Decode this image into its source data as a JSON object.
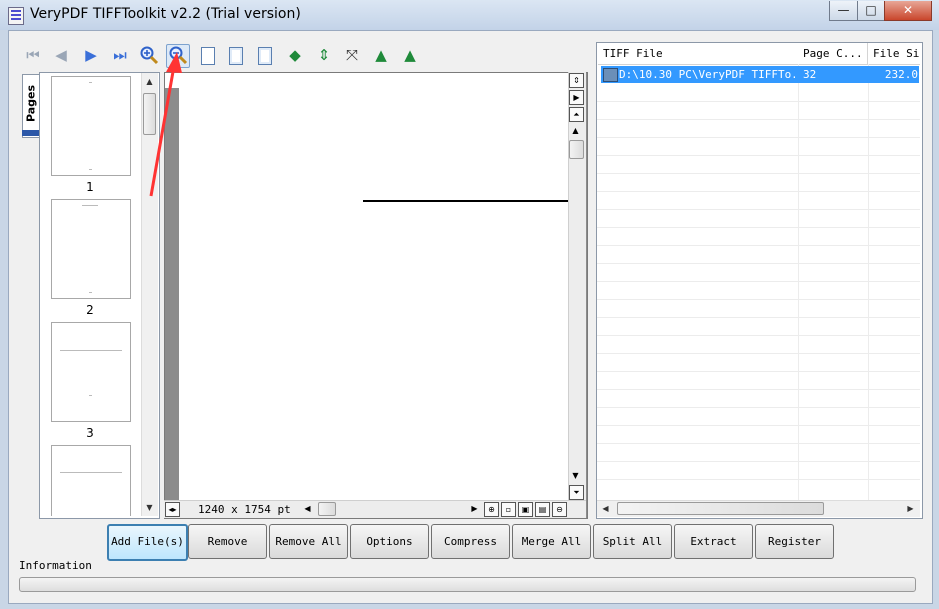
{
  "window": {
    "title": "VeryPDF TIFFToolkit v2.2 (Trial version)",
    "controls": {
      "minimize": "—",
      "maximize": "□",
      "close": "✕"
    }
  },
  "toolbar": {
    "icons": [
      "first-page",
      "previous-page",
      "next-page",
      "last-page",
      "zoom-in",
      "zoom-out",
      "actual-size",
      "fit-page",
      "fit-width",
      "flip-horizontal",
      "flip-vertical",
      "rotate",
      "rotate-left",
      "rotate-right"
    ]
  },
  "pages_tab": {
    "label": "Pages"
  },
  "thumbnails": [
    {
      "number": "1"
    },
    {
      "number": "2"
    },
    {
      "number": "3"
    }
  ],
  "preview": {
    "dimensions": "1240 x 1754 pt"
  },
  "file_list": {
    "columns": [
      "TIFF File",
      "Page C...",
      "File Si"
    ],
    "rows": [
      {
        "file": "D:\\10.30 PC\\VeryPDF TIFFTo...",
        "pages": "32",
        "size": "232.0"
      }
    ]
  },
  "buttons": {
    "add_files": "Add File(s)",
    "remove": "Remove",
    "remove_all": "Remove All",
    "options": "Options",
    "compress": "Compress",
    "merge_all": "Merge All",
    "split_all": "Split All",
    "extract": "Extract",
    "register": "Register"
  },
  "information_label": "Information",
  "colors": {
    "selection": "#3399ff",
    "annotation_arrow": "#ff3333"
  }
}
